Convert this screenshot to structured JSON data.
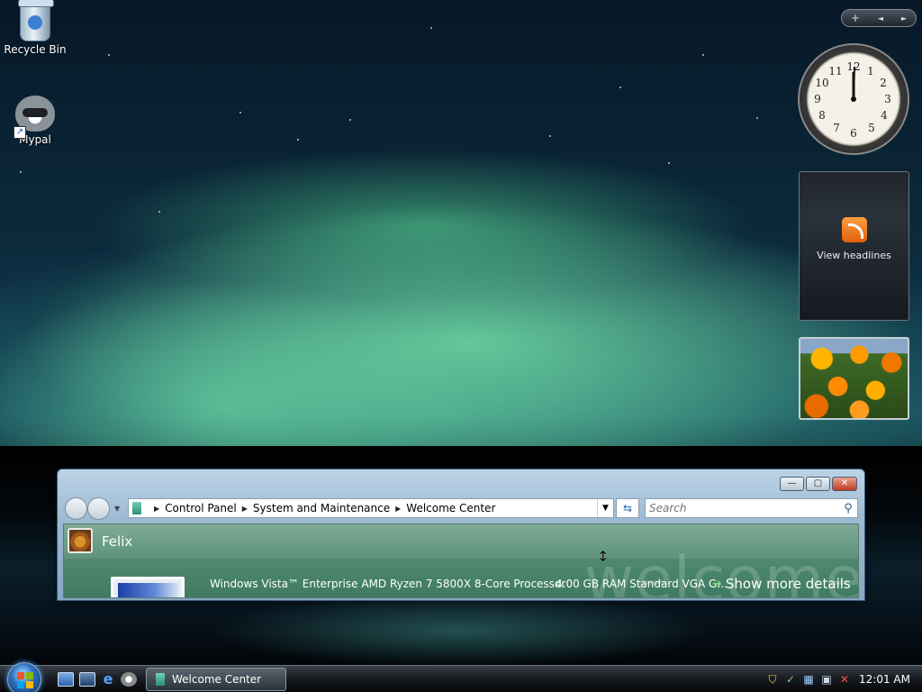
{
  "desktop": {
    "icons": [
      {
        "label": "Recycle Bin",
        "icon": "recycle-bin-icon"
      },
      {
        "label": "Mypal",
        "icon": "raccoon-icon"
      }
    ]
  },
  "sidebar": {
    "controls": {
      "add": "+",
      "prev": "◄",
      "next": "►"
    },
    "clock": {
      "hour": 12,
      "minute": 1
    },
    "feed_headlines": {
      "label": "View headlines",
      "icon": "rss-icon"
    },
    "slideshow": {
      "subject": "orange flowers"
    }
  },
  "window": {
    "title_buttons": {
      "minimize": "—",
      "maximize": "▢",
      "close": "✕"
    },
    "breadcrumb": [
      "Control Panel",
      "System and Maintenance",
      "Welcome Center"
    ],
    "search_placeholder": "Search",
    "username": "Felix",
    "welcome_watermark": "welcome",
    "system_info": "Windows Vista™ Enterprise AMD Ryzen 7 5800X 8-Core Processor",
    "ram_info": "4.00 GB RAM Standard VGA G...",
    "show_more": "Show more details"
  },
  "taskbar": {
    "quick_launch": [
      "show-desktop-icon",
      "switch-windows-icon",
      "internet-explorer-icon",
      "mypal-icon"
    ],
    "task": "Welcome Center",
    "tray_icons": [
      "security-shield-icon",
      "network-icon",
      "update-icon",
      "network-connection-icon",
      "volume-muted-icon"
    ],
    "time": "12:01 AM"
  }
}
